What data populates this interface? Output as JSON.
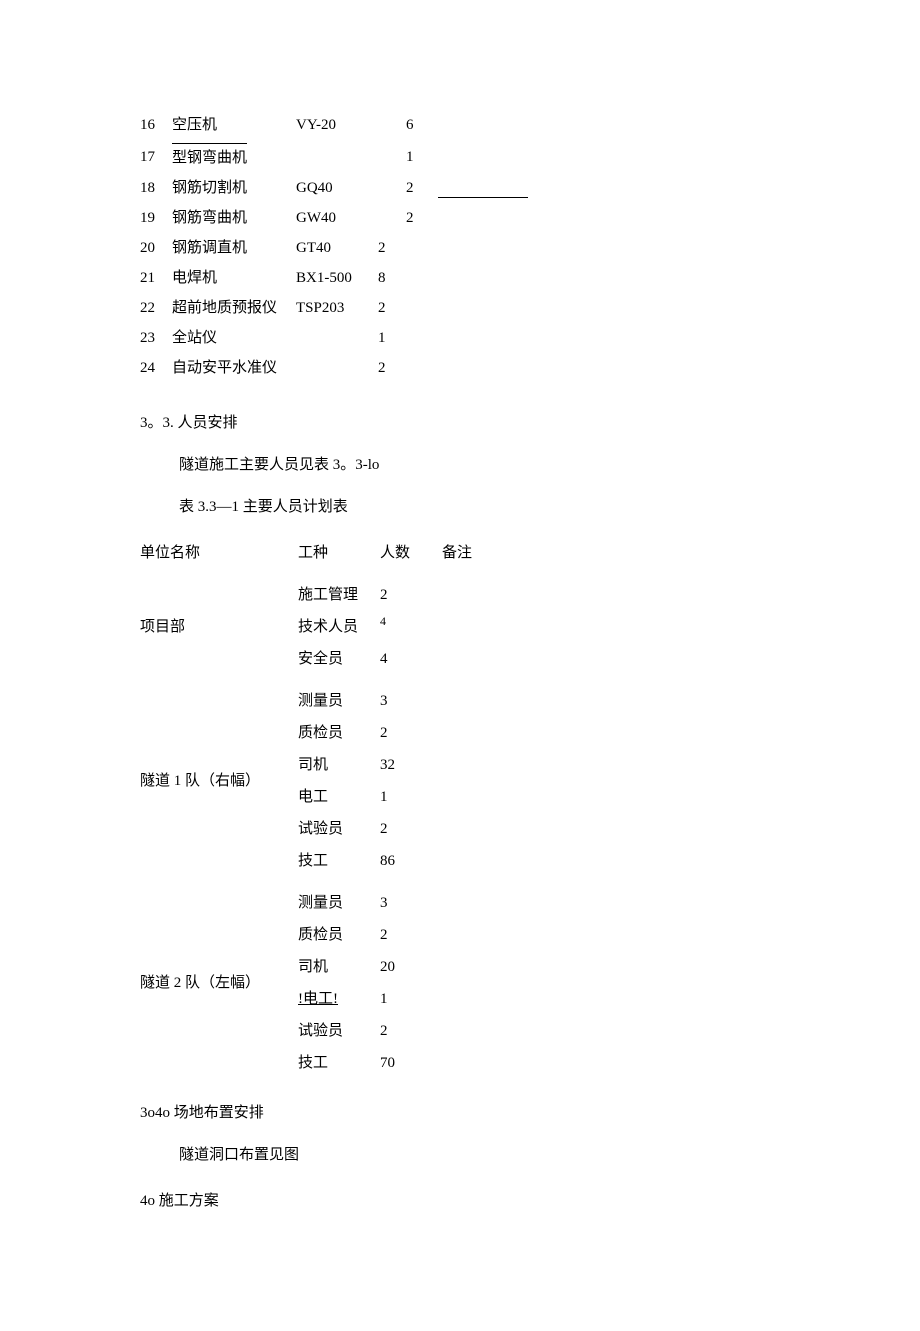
{
  "equipment": {
    "rows": [
      {
        "idx": "16",
        "name": "空压机",
        "model": "VY-20",
        "qty": "6",
        "under": false,
        "rule": false
      },
      {
        "idx": "17",
        "name": "型钢弯曲机",
        "model": "",
        "qty": "1",
        "under": true,
        "rule": false
      },
      {
        "idx": "18",
        "name": "钢筋切割机",
        "model": "GQ40",
        "qty": "2",
        "under": false,
        "rule": true
      },
      {
        "idx": "19",
        "name": "钢筋弯曲机",
        "model": "GW40",
        "qty": "2",
        "under": false,
        "rule": false
      },
      {
        "idx": "20",
        "name": "钢筋调直机",
        "model": "GT40",
        "qty": "2",
        "under": false,
        "rule": false
      },
      {
        "idx": "21",
        "name": "电焊机",
        "model": "BX1-500",
        "qty": "8",
        "under": false,
        "rule": false
      },
      {
        "idx": "22",
        "name": "超前地质预报仪",
        "model": "TSP203",
        "qty": "2",
        "under": false,
        "rule": false
      },
      {
        "idx": "23",
        "name": "全站仪",
        "model": "",
        "qty": "1",
        "under": false,
        "rule": false
      },
      {
        "idx": "24",
        "name": "自动安平水准仪",
        "model": "",
        "qty": "2",
        "under": false,
        "rule": false
      }
    ]
  },
  "sections": {
    "personnel_head": "3。3. 人员安排",
    "personnel_line": "隧道施工主要人员见表 3。3-lo",
    "personnel_table_title": "表 3.3—1 主要人员计划表",
    "site_layout_head": "3o4o 场地布置安排",
    "site_layout_line": "隧道洞口布置见图",
    "scheme_head": "4o 施工方案"
  },
  "personnel": {
    "headers": {
      "unit": "单位名称",
      "role": "工种",
      "num": "人数",
      "note": "备注"
    },
    "groups": [
      {
        "unit": "项目部",
        "rows": [
          {
            "role": "施工管理",
            "num": "2",
            "underline": false
          },
          {
            "role": "技术人员",
            "num": "4",
            "underline": false,
            "numSmall": true
          },
          {
            "role": "安全员",
            "num": "4",
            "underline": false
          }
        ],
        "unitRowIndex": 1
      },
      {
        "unit": "隧道 1 队（右幅）",
        "rows": [
          {
            "role": "测量员",
            "num": "3",
            "underline": false
          },
          {
            "role": "质检员",
            "num": "2",
            "underline": false
          },
          {
            "role": "司机",
            "num": "32",
            "underline": false
          },
          {
            "role": "电工",
            "num": "1",
            "underline": false
          },
          {
            "role": "试验员",
            "num": "2",
            "underline": false
          },
          {
            "role": "技工",
            "num": "86",
            "underline": false
          }
        ],
        "unitRowIndex": 2
      },
      {
        "unit": "隧道 2 队（左幅）",
        "rows": [
          {
            "role": "测量员",
            "num": "3",
            "underline": false
          },
          {
            "role": "质检员",
            "num": "2",
            "underline": false
          },
          {
            "role": "司机",
            "num": "20",
            "underline": false
          },
          {
            "role": "!电工!",
            "num": "1",
            "underline": true
          },
          {
            "role": "试验员",
            "num": "2",
            "underline": false
          },
          {
            "role": "技工",
            "num": "70",
            "underline": false
          }
        ],
        "unitRowIndex": 2
      }
    ]
  }
}
